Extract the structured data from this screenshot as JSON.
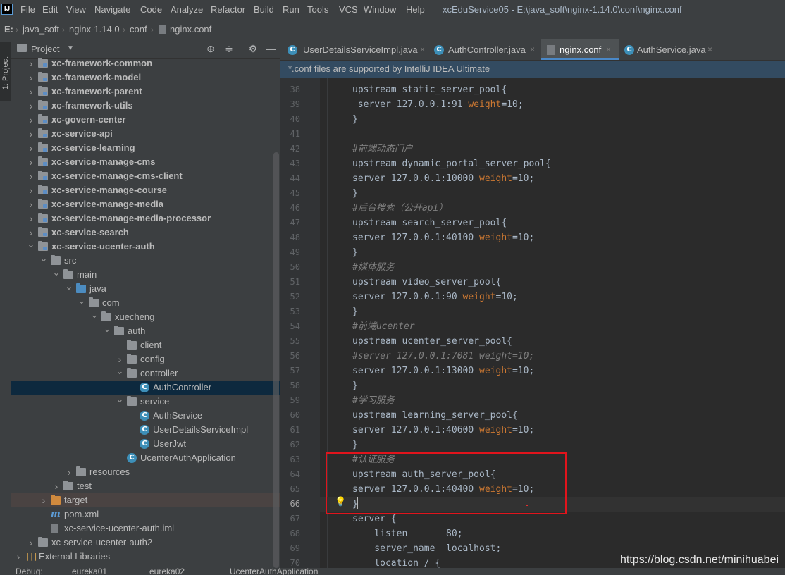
{
  "app": {
    "logo": "IJ",
    "window_title": "xcEduService05 - E:\\java_soft\\nginx-1.14.0\\conf\\nginx.conf"
  },
  "menu": [
    "File",
    "Edit",
    "View",
    "Navigate",
    "Code",
    "Analyze",
    "Refactor",
    "Build",
    "Run",
    "Tools",
    "VCS",
    "Window",
    "Help"
  ],
  "breadcrumb": [
    "E:",
    "java_soft",
    "nginx-1.14.0",
    "conf",
    "nginx.conf"
  ],
  "left_stripe": {
    "project_tab": "1: Project"
  },
  "project_panel": {
    "title": "Project",
    "tree": [
      {
        "label": "xc-framework-common",
        "bold": true
      },
      {
        "label": "xc-framework-model",
        "bold": true
      },
      {
        "label": "xc-framework-parent",
        "bold": true
      },
      {
        "label": "xc-framework-utils",
        "bold": true
      },
      {
        "label": "xc-govern-center",
        "bold": true
      },
      {
        "label": "xc-service-api",
        "bold": true
      },
      {
        "label": "xc-service-learning",
        "bold": true
      },
      {
        "label": "xc-service-manage-cms",
        "bold": true
      },
      {
        "label": "xc-service-manage-cms-client",
        "bold": true
      },
      {
        "label": "xc-service-manage-course",
        "bold": true
      },
      {
        "label": "xc-service-manage-media",
        "bold": true
      },
      {
        "label": "xc-service-manage-media-processor",
        "bold": true
      },
      {
        "label": "xc-service-search",
        "bold": true
      },
      {
        "label": "xc-service-ucenter-auth",
        "bold": true
      },
      {
        "label": "src"
      },
      {
        "label": "main"
      },
      {
        "label": "java"
      },
      {
        "label": "com"
      },
      {
        "label": "xuecheng"
      },
      {
        "label": "auth"
      },
      {
        "label": "client"
      },
      {
        "label": "config"
      },
      {
        "label": "controller"
      },
      {
        "label": "AuthController"
      },
      {
        "label": "service"
      },
      {
        "label": "AuthService"
      },
      {
        "label": "UserDetailsServiceImpl"
      },
      {
        "label": "UserJwt"
      },
      {
        "label": "UcenterAuthApplication"
      },
      {
        "label": "resources"
      },
      {
        "label": "test"
      },
      {
        "label": "target"
      },
      {
        "label": "pom.xml"
      },
      {
        "label": "xc-service-ucenter-auth.iml"
      },
      {
        "label": "xc-service-ucenter-auth2"
      },
      {
        "label": "External Libraries"
      }
    ]
  },
  "tabs": [
    {
      "label": "UserDetailsServiceImpl.java",
      "close": "×"
    },
    {
      "label": "AuthController.java",
      "close": "×"
    },
    {
      "label": "nginx.conf",
      "close": "×"
    },
    {
      "label": "AuthService.java",
      "close": "×"
    }
  ],
  "banner": "*.conf files are supported by IntelliJ IDEA Ultimate",
  "editor": {
    "lines": [
      {
        "n": "38",
        "text": "upstream static_server_pool{"
      },
      {
        "n": "39",
        "text": " server 127.0.0.1:91 weight=10;"
      },
      {
        "n": "40",
        "text": "}"
      },
      {
        "n": "41",
        "text": ""
      },
      {
        "n": "42",
        "text": "#前端动态门户"
      },
      {
        "n": "43",
        "text": "upstream dynamic_portal_server_pool{"
      },
      {
        "n": "44",
        "text": "server 127.0.0.1:10000 weight=10;"
      },
      {
        "n": "45",
        "text": "}"
      },
      {
        "n": "46",
        "text": "#后台搜索（公开api）"
      },
      {
        "n": "47",
        "text": "upstream search_server_pool{"
      },
      {
        "n": "48",
        "text": "server 127.0.0.1:40100 weight=10;"
      },
      {
        "n": "49",
        "text": "}"
      },
      {
        "n": "50",
        "text": "#媒体服务"
      },
      {
        "n": "51",
        "text": "upstream video_server_pool{"
      },
      {
        "n": "52",
        "text": "server 127.0.0.1:90 weight=10;"
      },
      {
        "n": "53",
        "text": "}"
      },
      {
        "n": "54",
        "text": "#前端ucenter"
      },
      {
        "n": "55",
        "text": "upstream ucenter_server_pool{"
      },
      {
        "n": "56",
        "text": "#server 127.0.0.1:7081 weight=10;"
      },
      {
        "n": "57",
        "text": "server 127.0.0.1:13000 weight=10;"
      },
      {
        "n": "58",
        "text": "}"
      },
      {
        "n": "59",
        "text": "#学习服务"
      },
      {
        "n": "60",
        "text": "upstream learning_server_pool{"
      },
      {
        "n": "61",
        "text": "server 127.0.0.1:40600 weight=10;"
      },
      {
        "n": "62",
        "text": "}"
      },
      {
        "n": "63",
        "text": "#认证服务"
      },
      {
        "n": "64",
        "text": "upstream auth_server_pool{"
      },
      {
        "n": "65",
        "text": "server 127.0.0.1:40400 weight=10;"
      },
      {
        "n": "66",
        "text": "}"
      },
      {
        "n": "67",
        "text": "server {"
      },
      {
        "n": "68",
        "text": "    listen       80;"
      },
      {
        "n": "69",
        "text": "    server_name  localhost;"
      },
      {
        "n": "70",
        "text": "    location / {"
      }
    ],
    "current_line": "66"
  },
  "watermark": "https://blog.csdn.net/minihuabei",
  "bottom_tabs": [
    "Debug:",
    "eureka01",
    "eureka02",
    "UcenterAuthApplication"
  ],
  "colors": {
    "keyword": "#cc7832",
    "comment": "#808080",
    "highlight_box": "#e1141c",
    "selection": "#0d293e"
  }
}
